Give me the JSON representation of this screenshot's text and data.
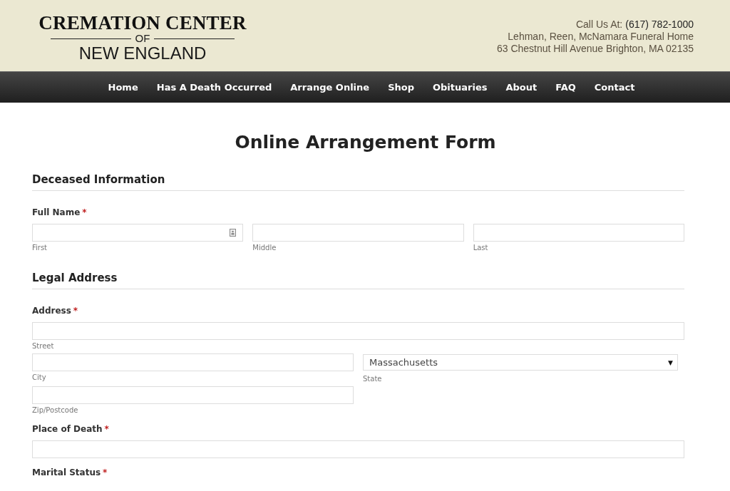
{
  "logo": {
    "line1": "CREMATION CENTER",
    "line2": "OF",
    "line3": "NEW ENGLAND"
  },
  "contact": {
    "call_label": "Call Us At:",
    "phone": "(617) 782-1000",
    "lines": [
      "Lehman, Reen, McNamara Funeral Home",
      "63 Chestnut Hill Avenue Brighton, MA 02135"
    ]
  },
  "nav": [
    {
      "label": "Home"
    },
    {
      "label": "Has A Death Occurred"
    },
    {
      "label": "Arrange Online"
    },
    {
      "label": "Shop"
    },
    {
      "label": "Obituaries"
    },
    {
      "label": "About"
    },
    {
      "label": "FAQ"
    },
    {
      "label": "Contact"
    }
  ],
  "form": {
    "title": "Online Arrangement Form",
    "blocks": [
      {
        "kind": "heading",
        "text": "Deceased Information"
      },
      {
        "kind": "field",
        "label": "Full Name",
        "required_mark": "*",
        "rows": [
          {
            "kind": "thirds",
            "cells": [
              {
                "kind": "text",
                "sublabel": "First",
                "card_icon": true
              },
              {
                "kind": "text",
                "sublabel": "Middle"
              },
              {
                "kind": "text",
                "sublabel": "Last"
              }
            ]
          }
        ]
      },
      {
        "kind": "heading",
        "text": "Legal Address"
      },
      {
        "kind": "field",
        "label": "Address",
        "required_mark": "*",
        "rows": [
          {
            "kind": "full",
            "cells": [
              {
                "kind": "text",
                "sublabel": "Street"
              }
            ]
          },
          {
            "kind": "halves",
            "cells": [
              {
                "kind": "text",
                "sublabel": "City"
              },
              {
                "kind": "select",
                "value": "Massachusetts",
                "caret": "▼",
                "sublabel": "State"
              }
            ]
          },
          {
            "kind": "halves",
            "cells": [
              {
                "kind": "text",
                "sublabel": "Zip/Postcode"
              }
            ]
          }
        ]
      },
      {
        "kind": "field",
        "label": "Place of Death",
        "required_mark": "*",
        "rows": [
          {
            "kind": "full",
            "cells": [
              {
                "kind": "text"
              }
            ]
          }
        ]
      },
      {
        "kind": "field",
        "label": "Marital Status",
        "required_mark": "*"
      }
    ]
  }
}
